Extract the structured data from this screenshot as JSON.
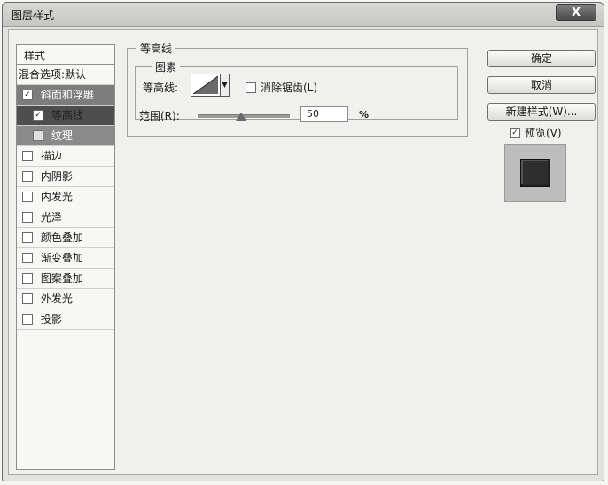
{
  "window": {
    "title": "图层样式",
    "close_label": "X"
  },
  "styles_list": {
    "header": "样式",
    "blend_label": "混合选项:默认",
    "items": [
      {
        "label": "斜面和浮雕",
        "checked": true,
        "state": "selected"
      },
      {
        "label": "等高线",
        "checked": true,
        "state": "sub-selected"
      },
      {
        "label": "纹理",
        "checked": false,
        "state": "sub"
      },
      {
        "label": "描边",
        "checked": false
      },
      {
        "label": "内阴影",
        "checked": false
      },
      {
        "label": "内发光",
        "checked": false
      },
      {
        "label": "光泽",
        "checked": false
      },
      {
        "label": "颜色叠加",
        "checked": false
      },
      {
        "label": "渐变叠加",
        "checked": false
      },
      {
        "label": "图案叠加",
        "checked": false
      },
      {
        "label": "外发光",
        "checked": false
      },
      {
        "label": "投影",
        "checked": false
      }
    ]
  },
  "contour_panel": {
    "legend": "等高线",
    "subgroup_legend": "图素",
    "contour_label": "等高线:",
    "antialias_label": "消除锯齿(L)",
    "antialias_checked": false,
    "range_label": "范围(R):",
    "range_value": "50",
    "range_unit": "%",
    "range_fraction": 0.5
  },
  "buttons": {
    "ok": "确定",
    "cancel": "取消",
    "new_style": "新建样式(W)..."
  },
  "preview": {
    "label": "预览(V)",
    "checked": true
  }
}
